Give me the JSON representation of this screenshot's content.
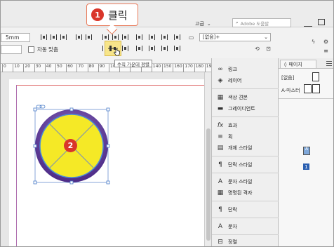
{
  "callout": {
    "step_number": "1",
    "step_text": "클릭",
    "step2_number": "2"
  },
  "topbar": {
    "workspace": "고급",
    "search_placeholder": "Adobe 도움말"
  },
  "toolbar": {
    "size_value": "5mm",
    "auto_fit_label": "자동 맞춤",
    "object_style_value": "[없음]+",
    "tooltip_text": "수직 가운데 정렬"
  },
  "ruler": {
    "ticks": [
      "0",
      "10",
      "20",
      "30",
      "40",
      "50",
      "60",
      "70",
      "80",
      "90",
      "100",
      "110",
      "120",
      "130",
      "140",
      "150",
      "160",
      "170",
      "180",
      "190"
    ]
  },
  "panel_left_items": [
    {
      "label": "링크",
      "icon": "link-icon"
    },
    {
      "label": "레이어",
      "icon": "layers-icon"
    },
    {
      "label": "색상 견본",
      "icon": "swatches-icon"
    },
    {
      "label": "그레이디언트",
      "icon": "gradient-icon"
    },
    {
      "label": "효과",
      "icon": "fx-icon"
    },
    {
      "label": "획",
      "icon": "stroke-icon"
    },
    {
      "label": "개체 스타일",
      "icon": "object-style-icon"
    },
    {
      "label": "단락 스타일",
      "icon": "paragraph-style-icon"
    },
    {
      "label": "문자 스타일",
      "icon": "character-style-icon"
    },
    {
      "label": "명명된 격자",
      "icon": "named-grid-icon"
    },
    {
      "label": "단락",
      "icon": "paragraph-icon"
    },
    {
      "label": "문자",
      "icon": "character-icon"
    },
    {
      "label": "정렬",
      "icon": "align-icon"
    }
  ],
  "pages_panel": {
    "tab_label": "페이지",
    "none_label": "[없음]",
    "master_label": "A-마스터",
    "page_number": "1"
  },
  "colors": {
    "circle_fill": "#f5e926",
    "circle_ring": "#6f4aa8",
    "circle_inner_ring": "#4a8fd8",
    "accent_red": "#d9362a"
  }
}
